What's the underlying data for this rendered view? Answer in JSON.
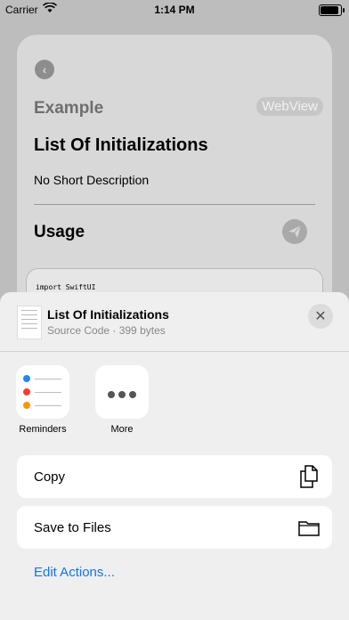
{
  "status_bar": {
    "carrier": "Carrier",
    "time": "1:14 PM"
  },
  "background_card": {
    "example_label": "Example",
    "webview_label": "WebView",
    "title": "List Of Initializations",
    "description": "No Short Description",
    "usage_label": "Usage",
    "code_preview": "import SwiftUI"
  },
  "share_sheet": {
    "document_title": "List Of Initializations",
    "document_meta": "Source Code · 399 bytes",
    "apps": [
      {
        "label": "Reminders",
        "icon": "reminders-icon"
      },
      {
        "label": "More",
        "icon": "more-icon"
      }
    ],
    "actions": [
      {
        "label": "Copy",
        "icon": "copy-icon"
      },
      {
        "label": "Save to Files",
        "icon": "folder-icon"
      }
    ],
    "edit_actions_label": "Edit Actions..."
  },
  "colors": {
    "link": "#1a73e8",
    "reminder_blue": "#1e88ff",
    "reminder_red": "#ff3b30",
    "reminder_orange": "#ff9500"
  }
}
